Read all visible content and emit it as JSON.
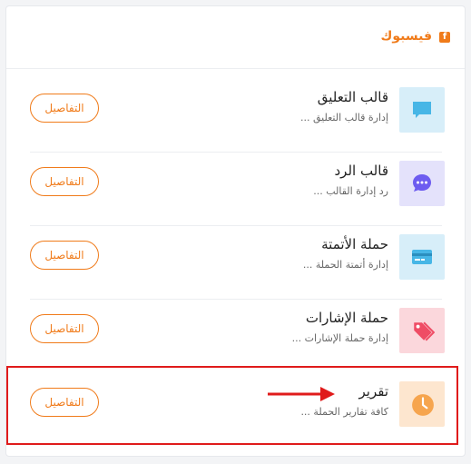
{
  "header": {
    "title": "فيسبوك",
    "icon": "facebook-icon"
  },
  "items": [
    {
      "title": "قالب التعليق",
      "desc": "إدارة قالب التعليق ...",
      "button": "التفاصيل",
      "icon": "comment-icon",
      "color": "#d7eef9",
      "iconColor": "#47b6e6"
    },
    {
      "title": "قالب الرد",
      "desc": "رد إدارة القالب ...",
      "button": "التفاصيل",
      "icon": "chat-bubble-icon",
      "color": "#e4e2fb",
      "iconColor": "#6d5cf0"
    },
    {
      "title": "حملة الأتمتة",
      "desc": "إدارة أتمتة الحملة ...",
      "button": "التفاصيل",
      "icon": "credit-card-icon",
      "color": "#d7eef9",
      "iconColor": "#47b6e6"
    },
    {
      "title": "حملة الإشارات",
      "desc": "إدارة حملة الإشارات ...",
      "button": "التفاصيل",
      "icon": "tags-icon",
      "color": "#fbd7dc",
      "iconColor": "#ef4c65"
    },
    {
      "title": "تقرير",
      "desc": "كافة تقارير الحملة ...",
      "button": "التفاصيل",
      "icon": "clock-icon",
      "color": "#fde6cf",
      "iconColor": "#f6a54e"
    }
  ],
  "accent": "#f07b1a",
  "annotation": {
    "highlight_color": "#e01b1b"
  }
}
